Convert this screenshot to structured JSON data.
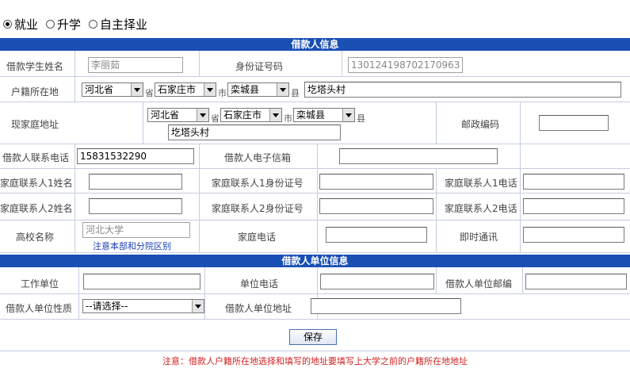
{
  "mode": {
    "options": [
      {
        "label": "就业",
        "selected": true
      },
      {
        "label": "升学",
        "selected": false
      },
      {
        "label": "自主择业",
        "selected": false
      }
    ]
  },
  "section1": {
    "title": "借款人信息"
  },
  "student_name": {
    "label": "借款学生姓名",
    "value": "李丽茹"
  },
  "id_number": {
    "label": "身份证号码",
    "value": "130124198702170963"
  },
  "household": {
    "label": "户籍所在地",
    "province": "河北省",
    "city": "石家庄市",
    "county": "栾城县",
    "u_province": "省",
    "u_city": "市",
    "u_county": "县",
    "detail": "圪塔头村"
  },
  "home_address": {
    "label": "现家庭地址",
    "province": "河北省",
    "city": "石家庄市",
    "county": "栾城县",
    "u_province": "省",
    "u_city": "市",
    "u_county": "县",
    "detail": "圪塔头村"
  },
  "postcode": {
    "label": "邮政编码",
    "value": ""
  },
  "phone": {
    "label": "借款人联系电话",
    "value": "15831532290"
  },
  "email": {
    "label": "借款人电子信箱",
    "value": ""
  },
  "contact1": {
    "name_label": "家庭联系人1姓名",
    "id_label": "家庭联系人1身份证号",
    "phone_label": "家庭联系人1电话"
  },
  "contact2": {
    "name_label": "家庭联系人2姓名",
    "id_label": "家庭联系人2身份证号",
    "phone_label": "家庭联系人2电话"
  },
  "school": {
    "label": "高校名称",
    "value": "河北大学",
    "hint": "注意本部和分院区别"
  },
  "home_phone": {
    "label": "家庭电话"
  },
  "im": {
    "label": "即时通讯"
  },
  "section2": {
    "title": "借款人单位信息"
  },
  "employer": {
    "label": "工作单位"
  },
  "work_phone": {
    "label": "单位电话"
  },
  "work_postcode": {
    "label": "借款人单位邮编"
  },
  "work_nature": {
    "label": "借款人单位性质",
    "value": "--请选择--"
  },
  "work_address": {
    "label": "借款人单位地址"
  },
  "save": {
    "label": "保存"
  },
  "notice": "注意：借款人户籍所在地选择和填写的地址要填写上大学之前的户籍所在地地址",
  "colors": {
    "band": "#1a4fb4",
    "notice": "#d42020",
    "link": "#1a3fb4"
  }
}
